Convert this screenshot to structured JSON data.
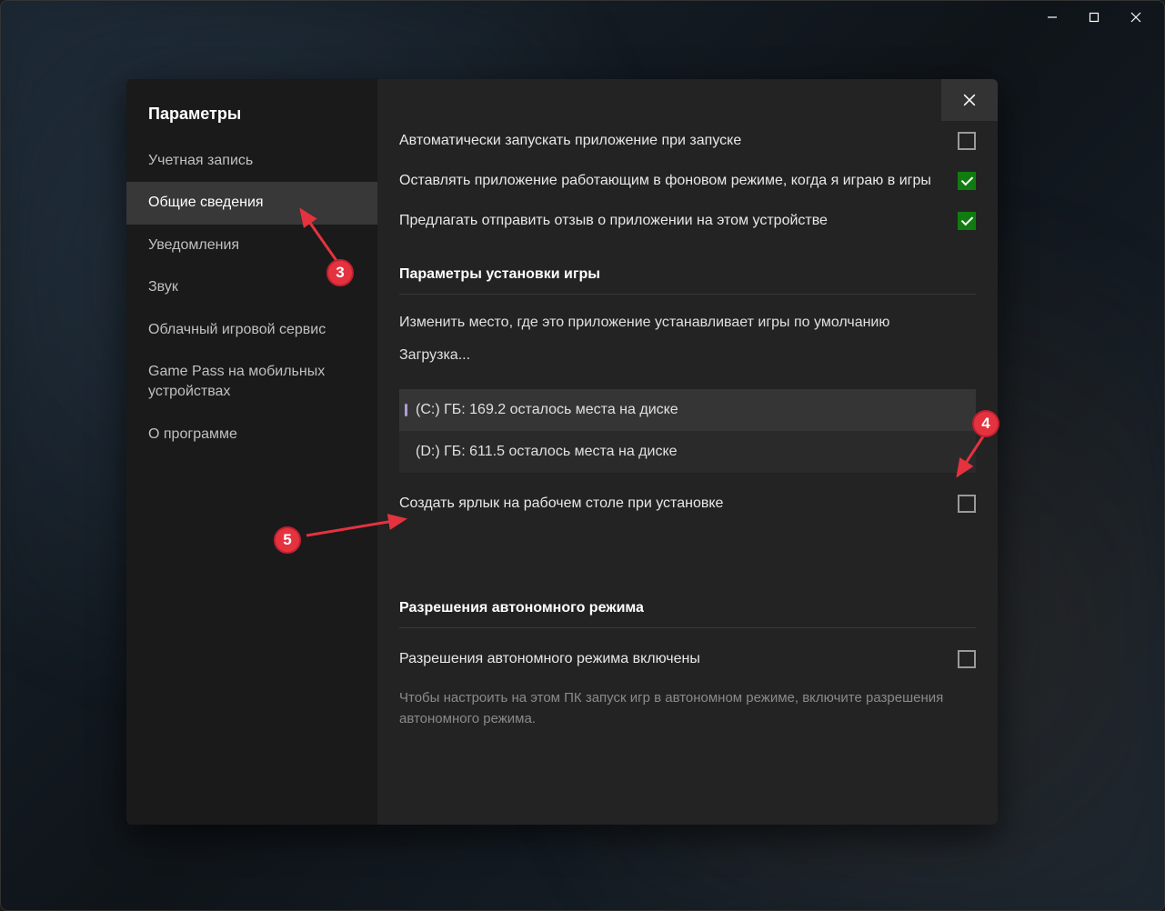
{
  "window": {
    "titlebar": {
      "minimize": "minimize",
      "maximize": "maximize",
      "close": "close"
    }
  },
  "dialog": {
    "title": "Параметры",
    "close": "close"
  },
  "sidebar": {
    "items": [
      {
        "label": "Учетная запись",
        "active": false
      },
      {
        "label": "Общие сведения",
        "active": true
      },
      {
        "label": "Уведомления",
        "active": false
      },
      {
        "label": "Звук",
        "active": false
      },
      {
        "label": "Облачный игровой сервис",
        "active": false
      },
      {
        "label": "Game Pass на мобильных устройствах",
        "active": false
      },
      {
        "label": "О программе",
        "active": false
      }
    ]
  },
  "general": {
    "auto_launch": {
      "label": "Автоматически запускать приложение при запуске",
      "checked": false
    },
    "keep_background": {
      "label": "Оставлять приложение работающим в фоновом режиме, когда я играю в игры",
      "checked": true
    },
    "send_feedback": {
      "label": "Предлагать отправить отзыв о приложении на этом устройстве",
      "checked": true
    }
  },
  "install": {
    "section_title": "Параметры установки игры",
    "change_location": "Изменить место, где это приложение устанавливает игры по умолчанию",
    "loading": "Загрузка...",
    "drives": [
      {
        "label": "(C:) ГБ: 169.2 осталось места на диске",
        "selected": true
      },
      {
        "label": "(D:) ГБ: 611.5 осталось места на диске",
        "selected": false
      }
    ],
    "create_shortcut": {
      "label": "Создать ярлык на рабочем столе при установке",
      "checked": false
    }
  },
  "offline": {
    "section_title": "Разрешения автономного режима",
    "enabled": {
      "label": "Разрешения автономного режима включены",
      "checked": false
    },
    "help": "Чтобы настроить на этом ПК запуск игр в автономном режиме, включите разрешения автономного режима."
  },
  "annotations": {
    "a3": "3",
    "a4": "4",
    "a5": "5"
  }
}
